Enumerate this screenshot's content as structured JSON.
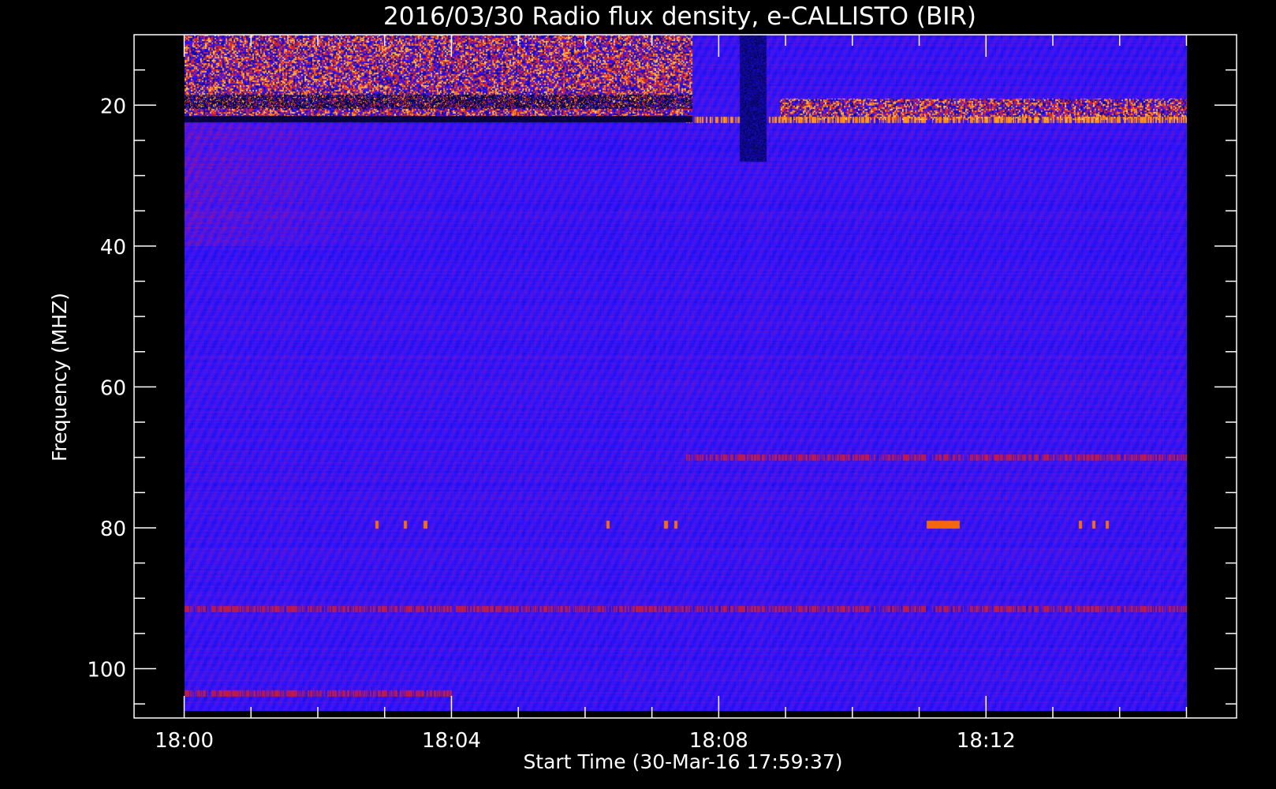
{
  "chart_data": {
    "type": "heatmap",
    "title": "2016/03/30  Radio flux density, e-CALLISTO (BIR)",
    "xlabel": "Start Time (30-Mar-16 17:59:37)",
    "ylabel": "Frequency (MHZ)",
    "x_ticks": [
      "18:00",
      "18:04",
      "18:08",
      "18:12"
    ],
    "x_tick_minutes": [
      0,
      4,
      8,
      12
    ],
    "x_minor_step_minutes": 1,
    "x_range_minutes": [
      -0.75,
      15.75
    ],
    "data_time_range_minutes": [
      0,
      15
    ],
    "y_ticks": [
      "20",
      "40",
      "60",
      "80",
      "100"
    ],
    "y_tick_values": [
      20,
      40,
      60,
      80,
      100
    ],
    "y_minor_step_mhz": 5,
    "y_range_mhz": [
      10,
      107
    ],
    "y_inverted": true,
    "data_freq_range_mhz": [
      10,
      106
    ],
    "colormap": "IDL blue-red (black -> blue -> red -> yellow -> white)",
    "colors": {
      "background": "#000000",
      "axis": "#ffffff",
      "low": "#000000",
      "base": "#2e12ff",
      "mid": "#c02040",
      "high": "#ff6a00",
      "peak": "#fff2a0"
    },
    "features": [
      {
        "kind": "band",
        "freq_mhz": [
          10,
          21.5
        ],
        "time_min": [
          0,
          7.6
        ],
        "intensity": "high"
      },
      {
        "kind": "band",
        "freq_mhz": [
          19,
          22
        ],
        "time_min": [
          8.9,
          15
        ],
        "intensity": "high"
      },
      {
        "kind": "line",
        "freq_mhz": 22,
        "time_min": [
          7.5,
          15
        ],
        "intensity": "high"
      },
      {
        "kind": "dark",
        "freq_mhz": [
          10,
          28
        ],
        "time_min": [
          8.3,
          8.7
        ],
        "intensity": "low"
      },
      {
        "kind": "line",
        "freq_mhz": 70,
        "time_min": [
          7.5,
          15
        ],
        "intensity": "mid"
      },
      {
        "kind": "spots",
        "freq_mhz": 79.5,
        "times_min": [
          2.87,
          3.3,
          3.6,
          6.33,
          7.2,
          7.35,
          13.4,
          13.6,
          13.8
        ],
        "intensity": "high"
      },
      {
        "kind": "patch",
        "freq_mhz": 79.5,
        "time_min": [
          11.1,
          11.6
        ],
        "intensity": "high"
      },
      {
        "kind": "line",
        "freq_mhz": 91.5,
        "time_min": [
          0,
          15
        ],
        "intensity": "mid"
      },
      {
        "kind": "line",
        "freq_mhz": 103.5,
        "time_min": [
          0,
          4
        ],
        "intensity": "mid"
      }
    ]
  }
}
